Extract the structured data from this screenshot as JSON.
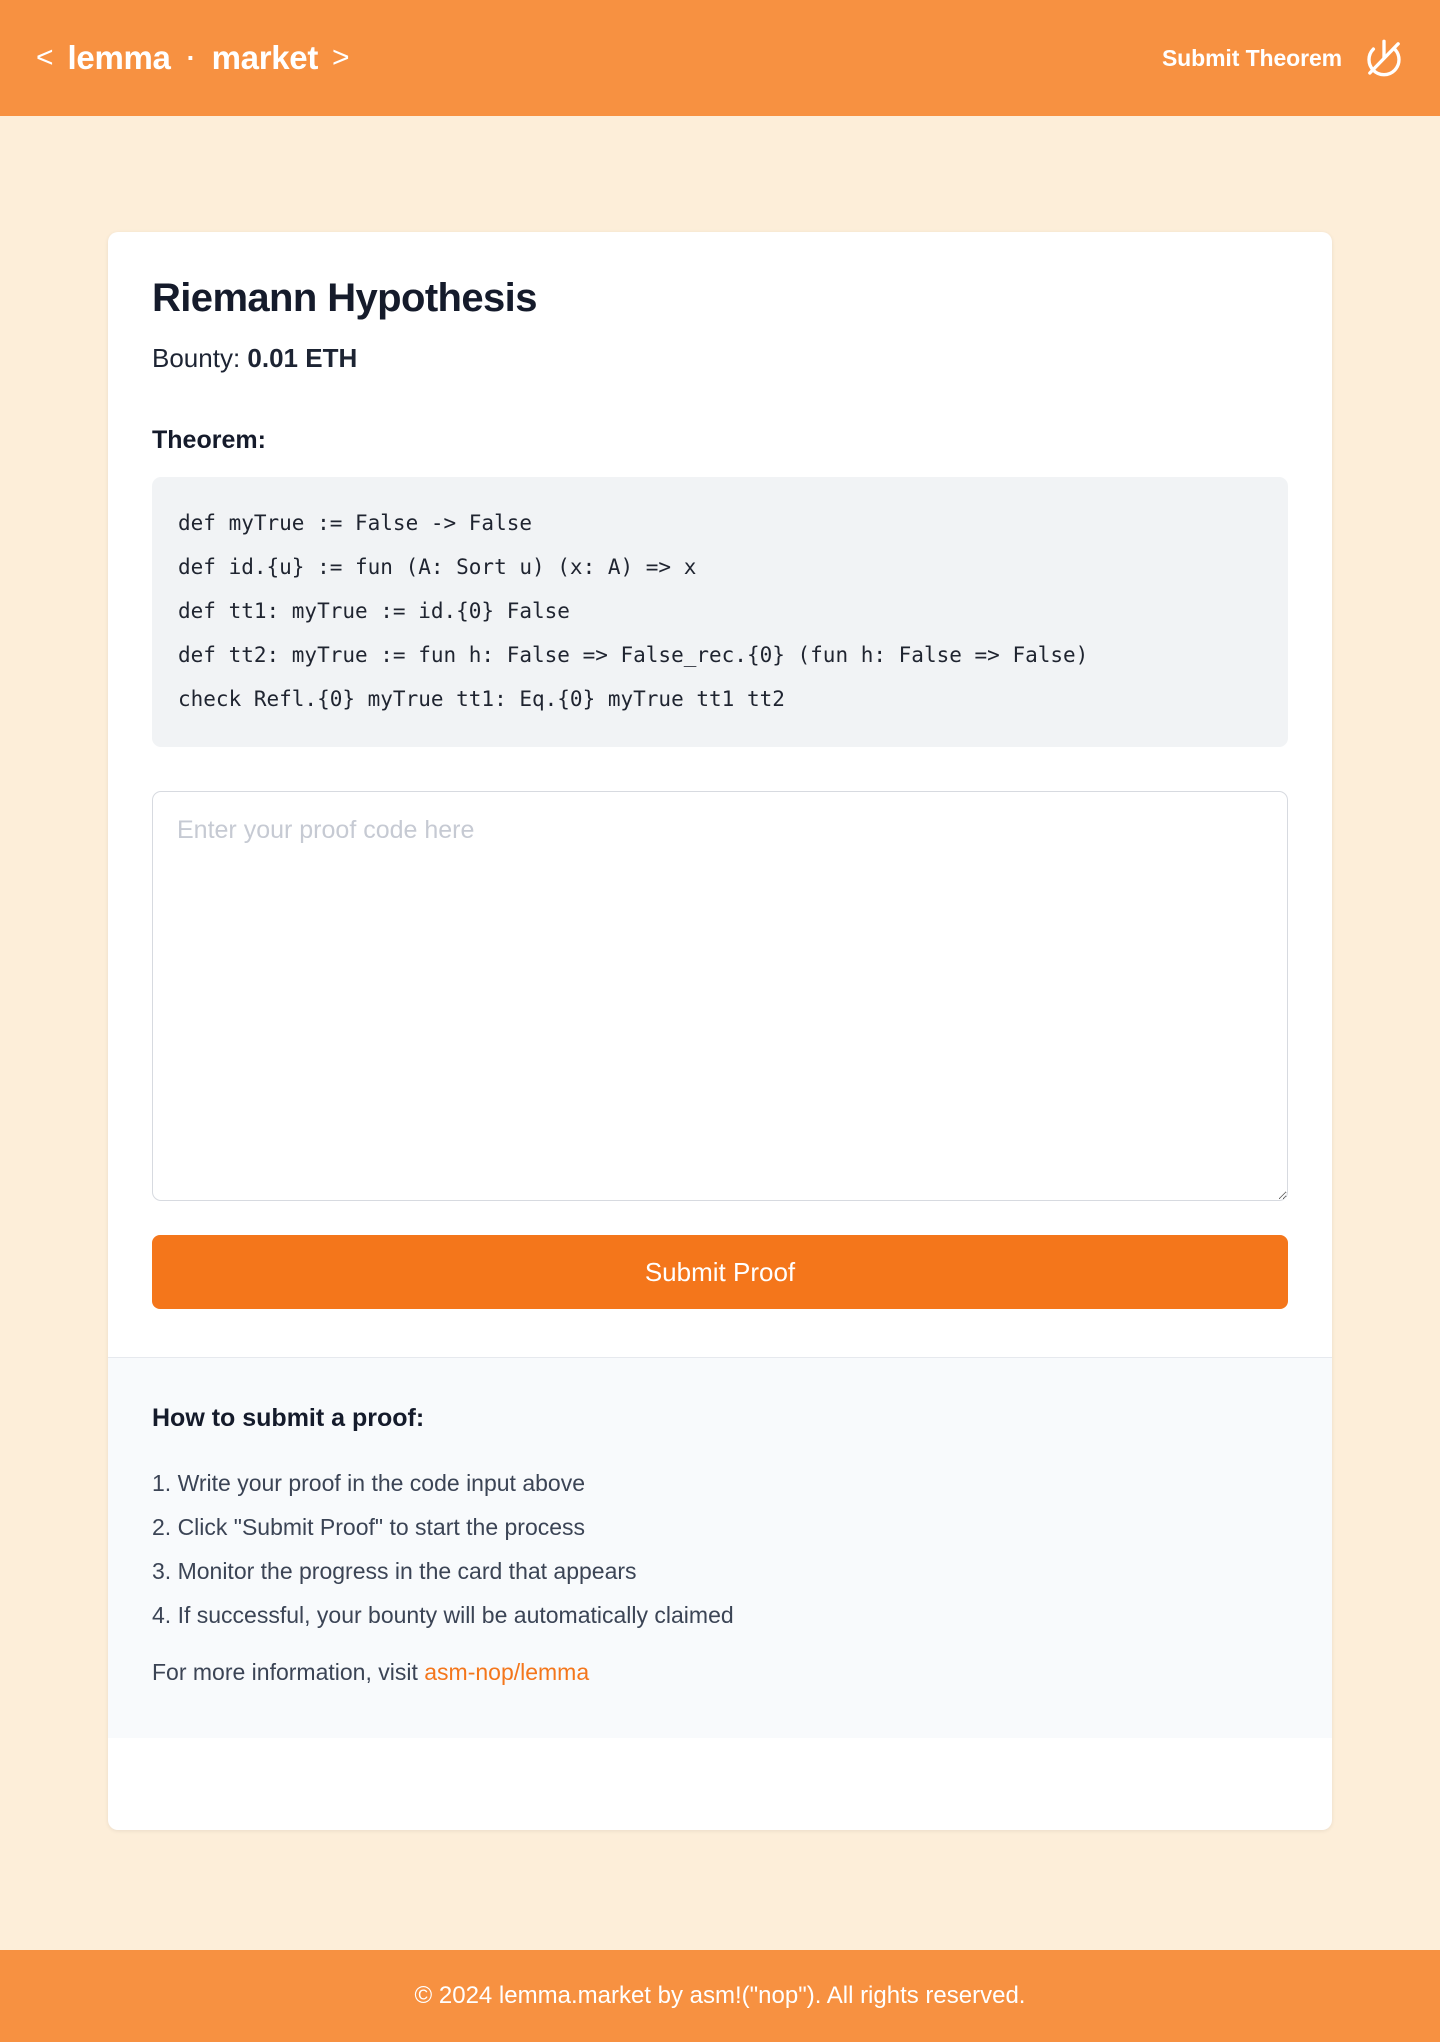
{
  "header": {
    "brand_prev": "<",
    "brand_first": "lemma",
    "brand_separator": "·",
    "brand_second": "market",
    "brand_next": ">",
    "submit_theorem_label": "Submit Theorem",
    "power_icon_name": "power-off-icon",
    "background_color": "#f79141",
    "text_color": "#ffffff"
  },
  "card": {
    "title": "Riemann Hypothesis",
    "bounty_label": "Bounty:",
    "bounty_value": "0.01 ETH",
    "theorem_label": "Theorem:",
    "theorem_code": [
      "def myTrue := False -> False",
      "def id.{u} := fun (A: Sort u) (x: A) => x",
      "def tt1: myTrue := id.{0} False",
      "def tt2: myTrue := fun h: False => False_rec.{0} (fun h: False => False)",
      "check Refl.{0} myTrue tt1: Eq.{0} myTrue tt1 tt2"
    ],
    "proof_input_placeholder": "Enter your proof code here",
    "proof_input_value": "",
    "submit_proof_label": "Submit Proof",
    "submit_button_color": "#f4761b"
  },
  "instructions": {
    "title": "How to submit a proof:",
    "steps": [
      "1. Write your proof in the code input above",
      "2. Click \"Submit Proof\" to start the process",
      "3. Monitor the progress in the card that appears",
      "4. If successful, your bounty will be automatically claimed"
    ],
    "more_info_prefix": "For more information, visit ",
    "more_info_link": "asm-nop/lemma",
    "link_color": "#f4761b"
  },
  "footer": {
    "text": "© 2024 lemma.market by asm!(\"nop\"). All rights reserved.",
    "background_color": "#f79141"
  }
}
